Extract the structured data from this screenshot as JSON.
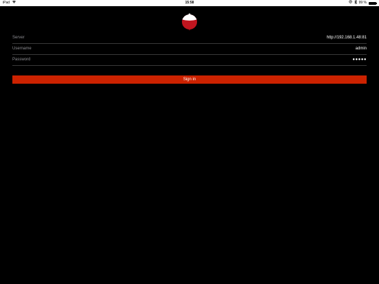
{
  "status_bar": {
    "device": "iPad",
    "time": "15:58",
    "battery_percent": "99 %",
    "battery_level": 0.99
  },
  "logo": {
    "icon": "bobber-logo-icon",
    "colors": {
      "red": "#c0151f",
      "white": "#ffffff"
    }
  },
  "form": {
    "server": {
      "label": "Server",
      "value": "http://192.168.1.48:81"
    },
    "username": {
      "label": "Username",
      "value": "admin"
    },
    "password": {
      "label": "Password",
      "value": "●●●●●"
    }
  },
  "signin": {
    "label": "Sign in",
    "color": "#cc2200"
  }
}
